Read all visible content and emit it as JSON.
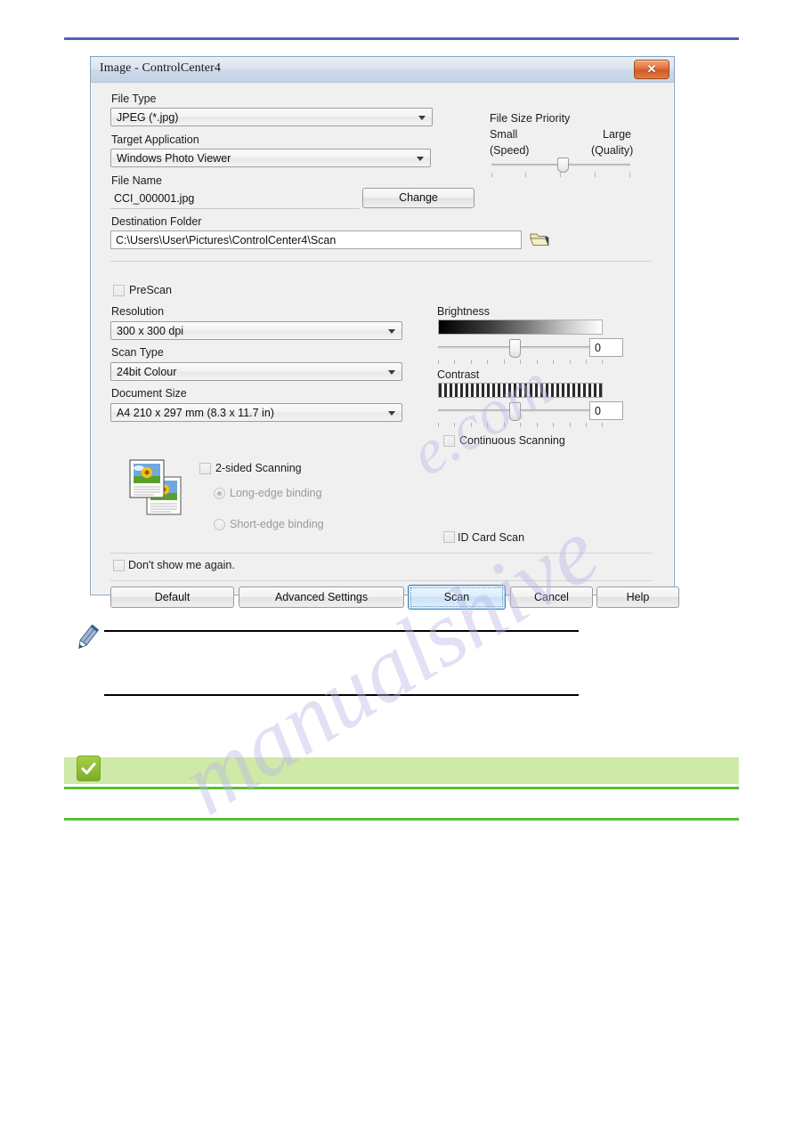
{
  "dialog": {
    "title": "Image - ControlCenter4",
    "close_icon": "close-icon",
    "fields": {
      "file_type_label": "File Type",
      "file_type_value": "JPEG (*.jpg)",
      "target_app_label": "Target Application",
      "target_app_value": "Windows Photo Viewer",
      "file_name_label": "File Name",
      "file_name_value": "CCI_000001.jpg",
      "change_button": "Change",
      "destination_label": "Destination Folder",
      "destination_value": "C:\\Users\\User\\Pictures\\ControlCenter4\\Scan",
      "browse_icon": "folder-icon",
      "prescan_label": "PreScan",
      "prescan_checked": false,
      "resolution_label": "Resolution",
      "resolution_value": "300 x 300 dpi",
      "scan_type_label": "Scan Type",
      "scan_type_value": "24bit Colour",
      "document_size_label": "Document Size",
      "document_size_value": "A4 210 x 297 mm (8.3 x 11.7 in)",
      "two_sided_label": "2-sided Scanning",
      "two_sided_checked": false,
      "long_edge_label": "Long-edge binding",
      "long_edge_selected": true,
      "short_edge_label": "Short-edge binding",
      "short_edge_selected": false,
      "id_card_label": "ID Card Scan",
      "id_card_checked": false,
      "dont_show_label": "Don't show me again.",
      "dont_show_checked": false,
      "doc_preview_icon": "document-pages-icon"
    },
    "file_size_priority": {
      "title": "File Size Priority",
      "small_label": "Small",
      "speed_label": "(Speed)",
      "large_label": "Large",
      "quality_label": "(Quality)",
      "value_percent": 51,
      "tick_count": 5
    },
    "brightness": {
      "label": "Brightness",
      "value": "0",
      "slider_percent": 50,
      "tick_count": 11
    },
    "contrast": {
      "label": "Contrast",
      "value": "0",
      "slider_percent": 50,
      "tick_count": 11
    },
    "continuous_scanning": {
      "label": "Continuous Scanning",
      "checked": false
    },
    "buttons": {
      "default": "Default",
      "advanced_settings": "Advanced Settings",
      "scan": "Scan",
      "cancel": "Cancel",
      "help": "Help"
    }
  },
  "page": {
    "note_icon": "pencil-note-icon",
    "tip_icon": "green-check-icon",
    "watermark_text_1": "manualshive",
    "watermark_text_2": "e.com",
    "accent_blue": "#5b5fb0",
    "accent_green": "#5cbf32",
    "band_green": "#cfe9a8"
  }
}
